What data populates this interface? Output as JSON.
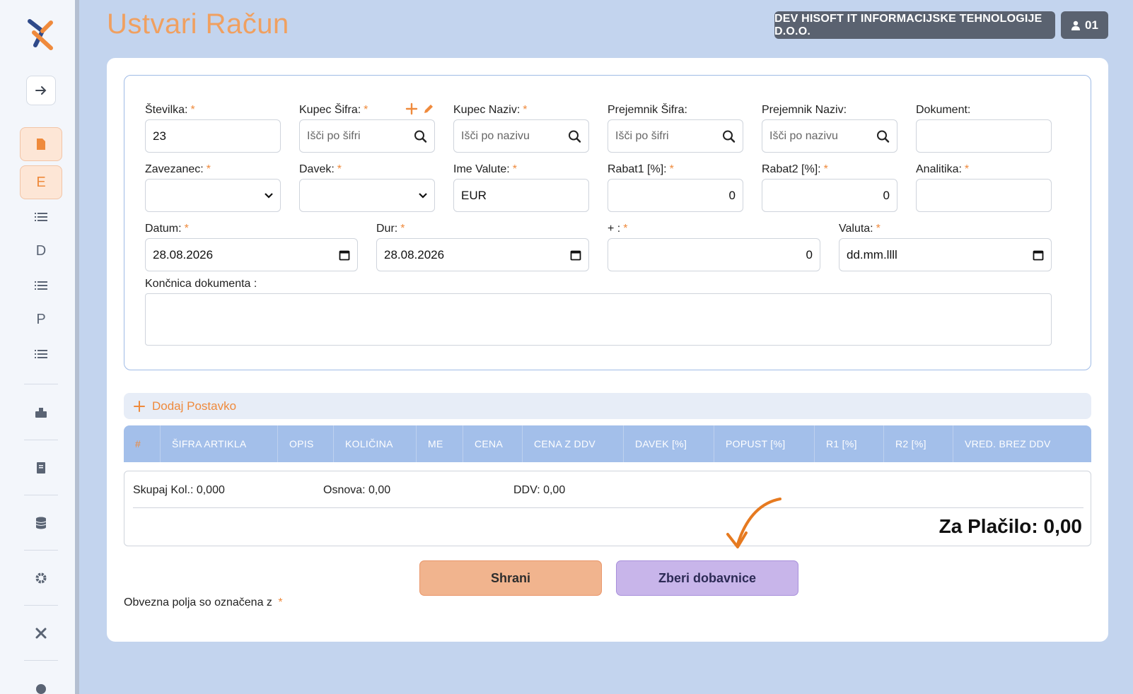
{
  "header": {
    "title": "Ustvari Račun",
    "company": "DEV HISOFT IT INFORMACIJSKE TEHNOLOGIJE D.O.O.",
    "user": "01"
  },
  "sidebar": {
    "items": [
      {
        "label": ""
      },
      {
        "label": "E"
      },
      {
        "label": ""
      },
      {
        "label": "D"
      },
      {
        "label": ""
      },
      {
        "label": "P"
      },
      {
        "label": ""
      }
    ],
    "icons": [
      "file-icon",
      "list-icon",
      "list-icon",
      "list-icon",
      "keyboard-icon",
      "book-icon",
      "database-icon",
      "gear-icon",
      "tools-icon",
      "brain-icon"
    ]
  },
  "form": {
    "stevilka": {
      "label": "Številka:",
      "value": "23"
    },
    "kupec_sifra": {
      "label": "Kupec Šifra:",
      "placeholder": "Išči po šifri"
    },
    "kupec_naziv": {
      "label": "Kupec Naziv:",
      "placeholder": "Išči po nazivu"
    },
    "prejemnik_sifra": {
      "label": "Prejemnik Šifra:",
      "placeholder": "Išči po šifri"
    },
    "prejemnik_naziv": {
      "label": "Prejemnik Naziv:",
      "placeholder": "Išči po nazivu"
    },
    "dokument": {
      "label": "Dokument:",
      "value": ""
    },
    "zavezanec": {
      "label": "Zavezanec:",
      "value": ""
    },
    "davek": {
      "label": "Davek:",
      "value": ""
    },
    "ime_valute": {
      "label": "Ime Valute:",
      "value": "EUR"
    },
    "rabat1": {
      "label": "Rabat1 [%]:",
      "value": "0"
    },
    "rabat2": {
      "label": "Rabat2 [%]:",
      "value": "0"
    },
    "analitika": {
      "label": "Analitika:",
      "value": ""
    },
    "datum": {
      "label": "Datum:",
      "value": "28.08.2026"
    },
    "dur": {
      "label": "Dur:",
      "value": "28.08.2026"
    },
    "plus": {
      "label": "+ :",
      "value": "0"
    },
    "valuta": {
      "label": "Valuta:",
      "value": "dd.mm.llll"
    },
    "koncnica": {
      "label": "Končnica dokumenta :",
      "value": ""
    },
    "required_mark": "*"
  },
  "items": {
    "add_label": "Dodaj Postavko",
    "columns": [
      "#",
      "ŠIFRA ARTIKLA",
      "OPIS",
      "KOLIČINA",
      "ME",
      "CENA",
      "CENA Z DDV",
      "DAVEK [%]",
      "POPUST [%]",
      "R1 [%]",
      "R2 [%]",
      "VRED. BREZ DDV"
    ]
  },
  "totals": {
    "skupaj": "Skupaj Kol.: 0,000",
    "osnova": "Osnova: 0,00",
    "ddv": "DDV: 0,00",
    "za_placilo": "Za Plačilo: 0,00"
  },
  "actions": {
    "save": "Shrani",
    "collect": "Zberi dobavnice"
  },
  "note": {
    "text": "Obvezna polja so označena z",
    "mark": "*"
  },
  "colors": {
    "accent": "#ef8a3c",
    "background": "#c3d4ee",
    "table_header": "#a3bfea",
    "save_button": "#f1b48e",
    "collect_button": "#c8b5ea"
  }
}
